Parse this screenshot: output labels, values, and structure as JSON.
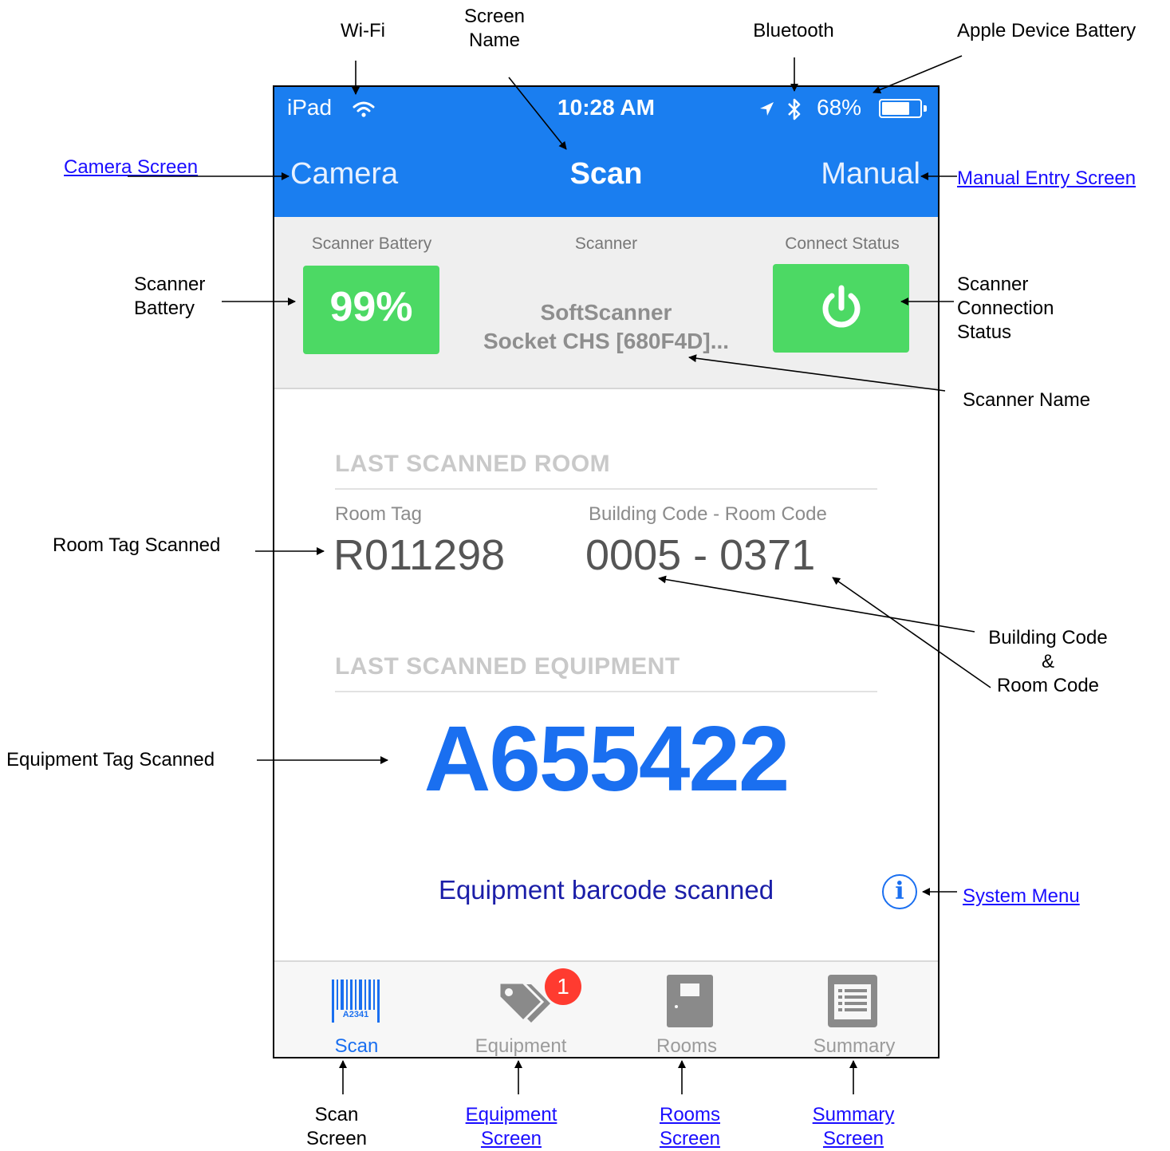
{
  "status_bar": {
    "device": "iPad",
    "time": "10:28 AM",
    "battery": "68%"
  },
  "nav_bar": {
    "left": "Camera",
    "title": "Scan",
    "right": "Manual"
  },
  "scanner": {
    "battery_label": "Scanner Battery",
    "battery_value": "99%",
    "scanner_label": "Scanner",
    "scanner_name_line1": "SoftScanner",
    "scanner_name_line2": "Socket CHS [680F4D]...",
    "connect_label": "Connect Status"
  },
  "last_room": {
    "title": "LAST SCANNED ROOM",
    "room_tag_label": "Room Tag",
    "room_tag": "R011298",
    "code_label": "Building Code - Room Code",
    "code": "0005 - 0371"
  },
  "last_equipment": {
    "title": "LAST SCANNED EQUIPMENT",
    "tag": "A655422"
  },
  "status_message": "Equipment barcode scanned",
  "tabs": [
    {
      "label": "Scan",
      "icon": "barcode-icon",
      "icon_text": "A2341"
    },
    {
      "label": "Equipment",
      "icon": "tags-icon",
      "badge": "1"
    },
    {
      "label": "Rooms",
      "icon": "door-icon"
    },
    {
      "label": "Summary",
      "icon": "list-document-icon"
    }
  ],
  "callouts": {
    "wifi": "Wi-Fi",
    "screen_name_1": "Screen",
    "screen_name_2": "Name",
    "bluetooth": "Bluetooth",
    "apple_battery": "Apple Device Battery",
    "camera_screen": "Camera Screen",
    "manual_entry_screen": "Manual Entry Screen",
    "scanner_battery_1": "Scanner",
    "scanner_battery_2": "Battery",
    "scanner_conn_1": "Scanner",
    "scanner_conn_2": "Connection",
    "scanner_conn_3": "Status",
    "scanner_name": "Scanner Name",
    "room_tag_scanned": "Room Tag Scanned",
    "building_code_1": "Building Code",
    "building_code_2": "&",
    "building_code_3": "Room Code",
    "equipment_tag_scanned": "Equipment Tag Scanned",
    "system_menu": "System Menu",
    "scan_screen_1": "Scan",
    "scan_screen_2": "Screen",
    "equipment_screen_1": "Equipment",
    "equipment_screen_2": "Screen",
    "rooms_screen_1": "Rooms",
    "rooms_screen_2": "Screen",
    "summary_screen_1": "Summary",
    "summary_screen_2": "Screen"
  },
  "colors": {
    "header_blue": "#1a7ef0",
    "accent_blue": "#1a6ff0",
    "green": "#4cd964",
    "badge_red": "#ff3b30",
    "link": "#1a0dff"
  }
}
